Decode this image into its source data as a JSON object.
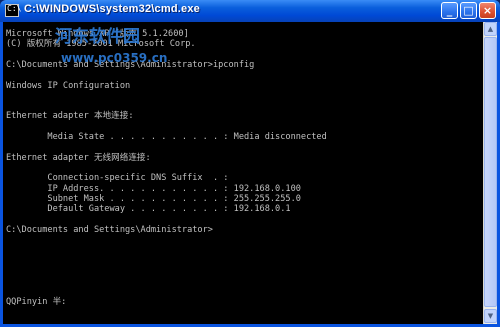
{
  "window": {
    "title": "C:\\WINDOWS\\system32\\cmd.exe",
    "icon_name": "cmd-icon",
    "minimize_label": "_",
    "maximize_label": "□",
    "close_label": "×"
  },
  "console": {
    "lines": [
      "Microsoft Windows XP [版本 5.1.2600]",
      "(C) 版权所有 1985-2001 Microsoft Corp.",
      "",
      "C:\\Documents and Settings\\Administrator>ipconfig",
      "",
      "Windows IP Configuration",
      "",
      "",
      "Ethernet adapter 本地连接:",
      "",
      "        Media State . . . . . . . . . . . : Media disconnected",
      "",
      "Ethernet adapter 无线网络连接:",
      "",
      "        Connection-specific DNS Suffix  . :",
      "        IP Address. . . . . . . . . . . . : 192.168.0.100",
      "        Subnet Mask . . . . . . . . . . . : 255.255.255.0",
      "        Default Gateway . . . . . . . . . : 192.168.0.1",
      "",
      "C:\\Documents and Settings\\Administrator>",
      "",
      "",
      "",
      "",
      "",
      "",
      "QQPinyin 半:"
    ]
  },
  "watermark": {
    "brand": "河东软件园",
    "url": "www.pc0359.cn"
  },
  "colors": {
    "title_bar": "#0a5fdc",
    "console_bg": "#000000",
    "console_text": "#c0c0c0"
  }
}
